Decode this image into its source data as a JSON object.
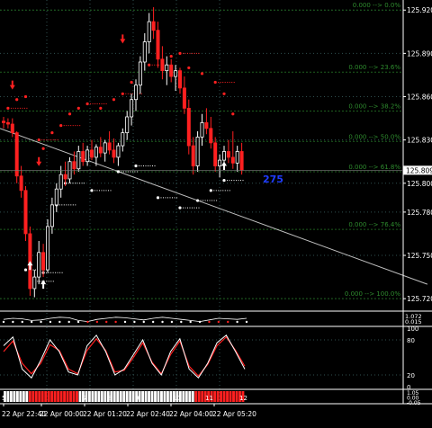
{
  "colors": {
    "background": "#000000",
    "grid": "#2f4f4f",
    "bull_candle": "#ffffff",
    "bear_candle": "#ff2020",
    "fib_line": "#1e5e1e",
    "fib_text": "#2e8b2e",
    "dots_red": "#ff2020",
    "dots_white": "#ffffff",
    "trendline": "#c0c0c0",
    "price_tag_bg": "#ffffff",
    "timer_text": "#1e3cff",
    "stoch_main": "#ffffff",
    "stoch_signal": "#ff2020",
    "axis_text": "#ffffff"
  },
  "header": {
    "time_readout": "275",
    "current_price": "125.809"
  },
  "price_axis": {
    "labels": [
      "125.920",
      "125.890",
      "125.860",
      "125.830",
      "125.800",
      "125.780",
      "125.750",
      "125.720"
    ]
  },
  "fib_levels": [
    {
      "label": "0.000 --> 0.0%",
      "price": 125.92
    },
    {
      "label": "0.000 --> 23.6%",
      "price": 125.877
    },
    {
      "label": "0.000 --> 38.2%",
      "price": 125.85
    },
    {
      "label": "0.000 --> 50.0%",
      "price": 125.829
    },
    {
      "label": "0.000 --> 61.8%",
      "price": 125.808
    },
    {
      "label": "0.000 --> 76.4%",
      "price": 125.768
    },
    {
      "label": "0.000 --> 100.0%",
      "price": 125.72
    }
  ],
  "indicator1": {
    "axis_labels": [
      "1.072",
      "0.015",
      "0.000"
    ]
  },
  "indicator2": {
    "axis_labels": [
      "100",
      "80",
      "20",
      "0"
    ]
  },
  "indicator3": {
    "axis_labels": [
      "1.05",
      "0.00",
      "-0.05"
    ],
    "bands": [
      {
        "color": "#ffffff",
        "bars": 8
      },
      {
        "color": "#ff2020",
        "bars": 16
      },
      {
        "color": "#ffffff",
        "bars": 37
      },
      {
        "color": "#ff2020",
        "bars": 16
      }
    ]
  },
  "time_axis": {
    "labels": [
      "22 Apr 22:40",
      "22 Apr 00:00",
      "22 Apr 01:20",
      "22 Apr 02:40",
      "22 Apr 04:00",
      "22 Apr 05:20"
    ],
    "date_labels": [
      "5",
      "7",
      "8",
      "9",
      "10",
      "11",
      "12"
    ]
  },
  "chart_data": {
    "type": "candlestick",
    "ylim": [
      125.712,
      125.927
    ],
    "candles": [
      [
        125.843,
        125.846,
        125.838,
        125.842
      ],
      [
        125.842,
        125.845,
        125.838,
        125.841
      ],
      [
        125.841,
        125.845,
        125.832,
        125.835
      ],
      [
        125.835,
        125.836,
        125.8,
        125.805
      ],
      [
        125.805,
        125.812,
        125.79,
        125.795
      ],
      [
        125.795,
        125.798,
        125.76,
        125.765
      ],
      [
        125.765,
        125.77,
        125.722,
        125.727
      ],
      [
        125.727,
        125.74,
        125.721,
        125.735
      ],
      [
        125.735,
        125.76,
        125.73,
        125.752
      ],
      [
        125.752,
        125.758,
        125.735,
        125.74
      ],
      [
        125.74,
        125.775,
        125.738,
        125.77
      ],
      [
        125.77,
        125.79,
        125.765,
        125.785
      ],
      [
        125.785,
        125.8,
        125.78,
        125.796
      ],
      [
        125.796,
        125.812,
        125.79,
        125.806
      ],
      [
        125.806,
        125.815,
        125.798,
        125.803
      ],
      [
        125.803,
        125.818,
        125.8,
        125.815
      ],
      [
        125.815,
        125.822,
        125.806,
        125.81
      ],
      [
        125.81,
        125.826,
        125.808,
        125.822
      ],
      [
        125.822,
        125.828,
        125.812,
        125.815
      ],
      [
        125.815,
        125.826,
        125.812,
        125.823
      ],
      [
        125.823,
        125.83,
        125.816,
        125.818
      ],
      [
        125.818,
        125.827,
        125.812,
        125.825
      ],
      [
        125.825,
        125.832,
        125.818,
        125.821
      ],
      [
        125.821,
        125.83,
        125.815,
        125.828
      ],
      [
        125.828,
        125.836,
        125.82,
        125.823
      ],
      [
        125.823,
        125.831,
        125.814,
        125.818
      ],
      [
        125.818,
        125.828,
        125.812,
        125.826
      ],
      [
        125.826,
        125.838,
        125.822,
        125.835
      ],
      [
        125.835,
        125.85,
        125.83,
        125.846
      ],
      [
        125.846,
        125.862,
        125.84,
        125.858
      ],
      [
        125.858,
        125.872,
        125.85,
        125.868
      ],
      [
        125.868,
        125.888,
        125.862,
        125.884
      ],
      [
        125.884,
        125.904,
        125.878,
        125.898
      ],
      [
        125.898,
        125.918,
        125.89,
        125.912
      ],
      [
        125.912,
        125.922,
        125.9,
        125.906
      ],
      [
        125.906,
        125.912,
        125.88,
        125.886
      ],
      [
        125.886,
        125.895,
        125.872,
        125.878
      ],
      [
        125.878,
        125.888,
        125.868,
        125.882
      ],
      [
        125.882,
        125.886,
        125.87,
        125.874
      ],
      [
        125.874,
        125.882,
        125.864,
        125.878
      ],
      [
        125.878,
        125.88,
        125.862,
        125.866
      ],
      [
        125.866,
        125.874,
        125.848,
        125.852
      ],
      [
        125.852,
        125.858,
        125.82,
        125.826
      ],
      [
        125.826,
        125.832,
        125.806,
        125.812
      ],
      [
        125.812,
        125.836,
        125.808,
        125.832
      ],
      [
        125.832,
        125.848,
        125.826,
        125.842
      ],
      [
        125.842,
        125.852,
        125.834,
        125.838
      ],
      [
        125.838,
        125.846,
        125.824,
        125.828
      ],
      [
        125.828,
        125.832,
        125.808,
        125.812
      ],
      [
        125.812,
        125.82,
        125.804,
        125.816
      ],
      [
        125.816,
        125.826,
        125.81,
        125.822
      ],
      [
        125.822,
        125.83,
        125.814,
        125.818
      ],
      [
        125.818,
        125.836,
        125.81,
        125.814
      ],
      [
        125.814,
        125.826,
        125.808,
        125.822
      ],
      [
        125.822,
        125.828,
        125.806,
        125.809
      ]
    ],
    "trendline": [
      [
        125.838,
        0
      ],
      [
        125.73,
        1.06
      ]
    ],
    "sar_red_dots": [
      [
        1,
        125.852
      ],
      [
        3,
        125.858
      ],
      [
        5,
        125.86
      ],
      [
        8,
        125.83
      ],
      [
        9,
        125.824
      ],
      [
        11,
        125.835
      ],
      [
        13,
        125.84
      ],
      [
        15,
        125.848
      ],
      [
        17,
        125.852
      ],
      [
        19,
        125.855
      ],
      [
        22,
        125.852
      ],
      [
        25,
        125.858
      ],
      [
        27,
        125.862
      ],
      [
        29,
        125.87
      ],
      [
        31,
        125.88
      ],
      [
        33,
        125.882
      ],
      [
        36,
        125.882
      ],
      [
        38,
        125.888
      ],
      [
        40,
        125.89
      ],
      [
        42,
        125.88
      ],
      [
        45,
        125.876
      ],
      [
        48,
        125.87
      ],
      [
        50,
        125.862
      ],
      [
        52,
        125.848
      ]
    ],
    "sar_white_dots": [
      [
        5,
        125.74
      ],
      [
        7,
        125.732
      ],
      [
        9,
        125.738
      ],
      [
        12,
        125.785
      ],
      [
        14,
        125.8
      ],
      [
        20,
        125.795
      ],
      [
        26,
        125.808
      ],
      [
        30,
        125.812
      ],
      [
        35,
        125.79
      ],
      [
        40,
        125.783
      ],
      [
        44,
        125.788
      ],
      [
        47,
        125.795
      ],
      [
        50,
        125.802
      ]
    ],
    "arrows": [
      {
        "i": 2,
        "price": 125.868,
        "dir": "down"
      },
      {
        "i": 8,
        "price": 125.815,
        "dir": "down"
      },
      {
        "i": 27,
        "price": 125.9,
        "dir": "down"
      },
      {
        "i": 6,
        "price": 125.743,
        "dir": "up"
      },
      {
        "i": 9,
        "price": 125.73,
        "dir": "up"
      },
      {
        "i": 50,
        "price": 125.812,
        "dir": "up"
      }
    ],
    "stochastic": {
      "main": [
        70,
        85,
        30,
        15,
        45,
        80,
        60,
        25,
        20,
        70,
        88,
        60,
        20,
        30,
        55,
        80,
        40,
        20,
        60,
        82,
        30,
        15,
        40,
        75,
        88,
        60,
        30
      ],
      "signal": [
        60,
        78,
        40,
        22,
        40,
        72,
        62,
        30,
        22,
        62,
        82,
        62,
        25,
        28,
        50,
        75,
        42,
        22,
        55,
        78,
        35,
        18,
        38,
        70,
        85,
        62,
        35
      ]
    },
    "indicator1_series": [
      0.4,
      0.5,
      0.45,
      0.3,
      0.35,
      0.5,
      0.6,
      0.55,
      0.3,
      0.2,
      0.4,
      0.5,
      0.6,
      0.55,
      0.45,
      0.35,
      0.5,
      0.6,
      0.5,
      0.4,
      0.3,
      0.2,
      0.35,
      0.5,
      0.45,
      0.4,
      0.5
    ]
  }
}
